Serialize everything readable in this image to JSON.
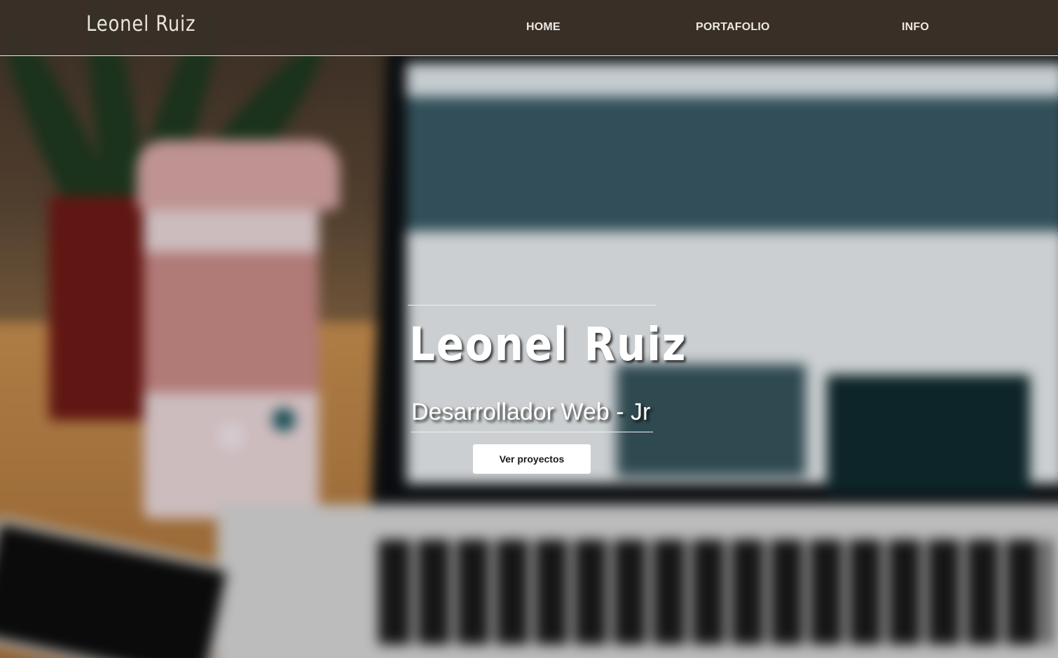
{
  "navbar": {
    "brand": "Leonel Ruiz",
    "links": [
      {
        "label": "HOME"
      },
      {
        "label": "PORTAFOLIO"
      },
      {
        "label": "INFO"
      }
    ]
  },
  "hero": {
    "name": "Leonel Ruiz",
    "subtitle": "Desarrollador Web - Jr",
    "cta_label": "Ver proyectos",
    "background": "blurred-desk-laptop-photo"
  },
  "colors": {
    "navbar_bg": "#3a3028",
    "nav_text": "#ece8e4",
    "button_bg": "#ffffff",
    "button_text": "#1a1a1a"
  }
}
